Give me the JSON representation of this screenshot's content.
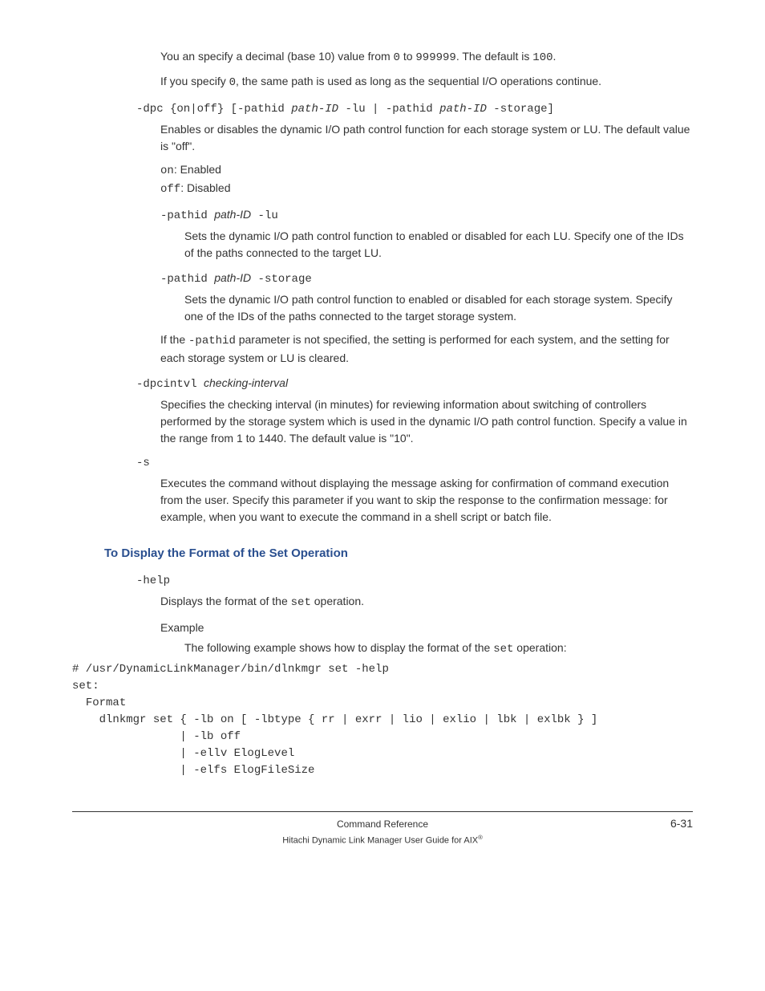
{
  "p1": {
    "pre": "You an specify a decimal (base 10) value from ",
    "c1": "0",
    "mid": " to ",
    "c2": "999999",
    "post": ". The default is ",
    "c3": "100",
    "end": "."
  },
  "p2": {
    "pre": "If you specify ",
    "c1": "0",
    "post": ", the same path is used as long as the sequential I/O operations continue."
  },
  "dpc_sig": {
    "a": "-dpc {on|off} [-pathid ",
    "b": "path-ID",
    "c": " -lu | -pathid ",
    "d": "path-ID",
    "e": " -storage]"
  },
  "dpc_desc": "Enables or disables the dynamic I/O path control function for each storage system or LU. The default value is \"off\".",
  "dpc_on": {
    "c": "on",
    "t": ": Enabled"
  },
  "dpc_off": {
    "c": "off",
    "t": ": Disabled"
  },
  "pathid_lu": {
    "a": "-pathid ",
    "b": "path-ID",
    "c": " -lu"
  },
  "pathid_lu_desc": "Sets the dynamic I/O path control function to enabled or disabled for each LU. Specify one of the IDs of the paths connected to the target LU.",
  "pathid_st": {
    "a": "-pathid ",
    "b": "path-ID",
    "c": " -storage"
  },
  "pathid_st_desc": "Sets the dynamic I/O path control function to enabled or disabled for each storage system. Specify one of the IDs of the paths connected to the target storage system.",
  "dpc_note": {
    "pre": "If the ",
    "c": "-pathid",
    "post": " parameter is not specified, the setting is performed for each system, and the setting for each storage system or LU is cleared."
  },
  "dpcintvl_sig": {
    "a": "-dpcintvl ",
    "b": "checking-interval"
  },
  "dpcintvl_desc": "Specifies the checking interval (in minutes) for reviewing information about switching of controllers performed by the storage system which is used in the dynamic I/O path control function. Specify a value in the range from 1 to 1440. The default value is \"10\".",
  "s_sig": "-s",
  "s_desc": "Executes the command without displaying the message asking for confirmation of command execution from the user. Specify this parameter if you want to skip the response to the confirmation message: for example, when you want to execute the command in a shell script or batch file.",
  "heading": "To Display the Format of the Set Operation",
  "help_sig": "-help",
  "help_desc": {
    "pre": "Displays the format of the ",
    "c": "set",
    "post": " operation."
  },
  "example_label": "Example",
  "example_desc": {
    "pre": "The following example shows how to display the format of the ",
    "c": "set",
    "post": " operation:"
  },
  "example_code": "# /usr/DynamicLinkManager/bin/dlnkmgr set -help\nset:\n  Format\n    dlnkmgr set { -lb on [ -lbtype { rr | exrr | lio | exlio | lbk | exlbk } ]\n                | -lb off\n                | -ellv ElogLevel\n                | -elfs ElogFileSize",
  "footer": {
    "section": "Command Reference",
    "pagenum": "6-31",
    "title_pre": "Hitachi Dynamic Link Manager User Guide for AIX",
    "reg": "®"
  }
}
